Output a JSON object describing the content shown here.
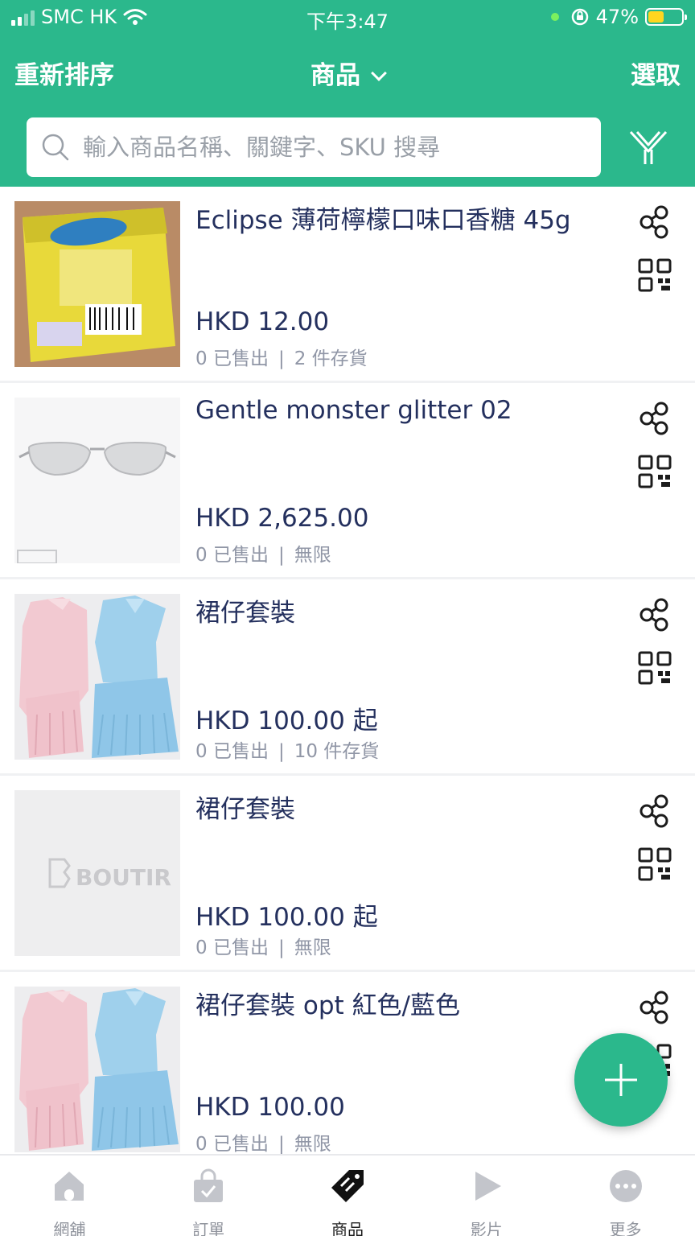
{
  "status_bar": {
    "carrier": "SMC HK",
    "time": "下午3:47",
    "battery": "47%",
    "battery_level": 0.47
  },
  "nav": {
    "left_label": "重新排序",
    "title": "商品",
    "right_label": "選取"
  },
  "search": {
    "placeholder": "輸入商品名稱、關鍵字、SKU 搜尋"
  },
  "products": [
    {
      "title": "Eclipse 薄荷檸檬口味口香糖 45g",
      "price": "HKD 12.00",
      "sold": "0 已售出",
      "stock": "2 件存貨",
      "image": "eclipse-gum"
    },
    {
      "title": "Gentle monster glitter 02",
      "price": "HKD 2,625.00",
      "sold": "0 已售出",
      "stock": "無限",
      "image": "sunglasses"
    },
    {
      "title": "裙仔套裝",
      "price": "HKD 100.00 起",
      "sold": "0 已售出",
      "stock": "10 件存貨",
      "image": "dress-set"
    },
    {
      "title": "裙仔套裝",
      "price": "HKD 100.00 起",
      "sold": "0 已售出",
      "stock": "無限",
      "image": "placeholder-boutir",
      "placeholder_text": "BOUTIR"
    },
    {
      "title": "裙仔套裝 opt 紅色/藍色",
      "price": "HKD 100.00",
      "sold": "0 已售出",
      "stock": "無限",
      "image": "dress-set"
    }
  ],
  "tabs": [
    {
      "label": "網舖",
      "icon": "home-icon",
      "active": false
    },
    {
      "label": "訂單",
      "icon": "bag-icon",
      "active": false
    },
    {
      "label": "商品",
      "icon": "tag-icon",
      "active": true
    },
    {
      "label": "影片",
      "icon": "play-icon",
      "active": false
    },
    {
      "label": "更多",
      "icon": "more-icon",
      "active": false
    }
  ],
  "colors": {
    "accent": "#2bb88c",
    "text_primary": "#24305e",
    "text_muted": "#9096a6"
  }
}
